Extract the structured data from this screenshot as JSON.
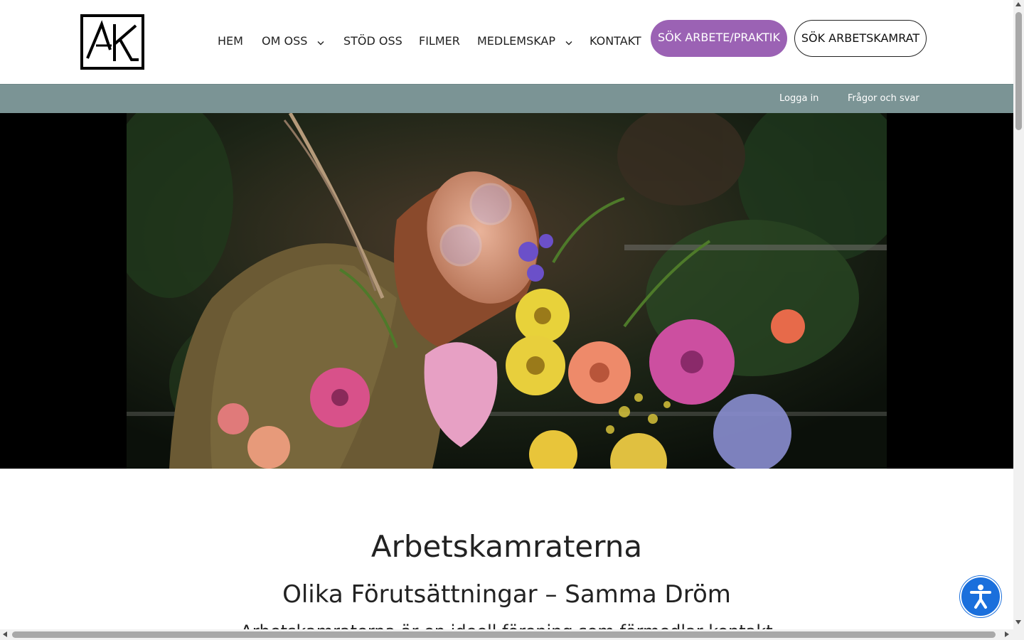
{
  "header": {
    "logo_text": "AK",
    "nav": [
      {
        "label": "HEM",
        "has_dropdown": false
      },
      {
        "label": "OM OSS",
        "has_dropdown": true
      },
      {
        "label": "STÖD OSS",
        "has_dropdown": false
      },
      {
        "label": "FILMER",
        "has_dropdown": false
      },
      {
        "label": "MEDLEMSKAP",
        "has_dropdown": true
      },
      {
        "label": "KONTAKT",
        "has_dropdown": false
      }
    ],
    "cta_primary": "SÖK ARBETE/PRAKTIK",
    "cta_secondary": "SÖK ARBETSKAMRAT"
  },
  "topbar": {
    "login": "Logga in",
    "faq": "Frågor och svar"
  },
  "hero": {
    "image_icon": "hero-photo"
  },
  "main": {
    "title": "Arbetskamraterna",
    "subtitle": "Olika Förutsättningar – Samma Dröm",
    "intro": "Arbetskamraterna är en ideell förening som förmedlar kontakt"
  },
  "accessibility": {
    "icon": "accessibility-icon"
  },
  "colors": {
    "brand_purple": "#9b62b4",
    "topbar_gray": "#7b9495",
    "accessibility_blue": "#1a6fdc"
  }
}
